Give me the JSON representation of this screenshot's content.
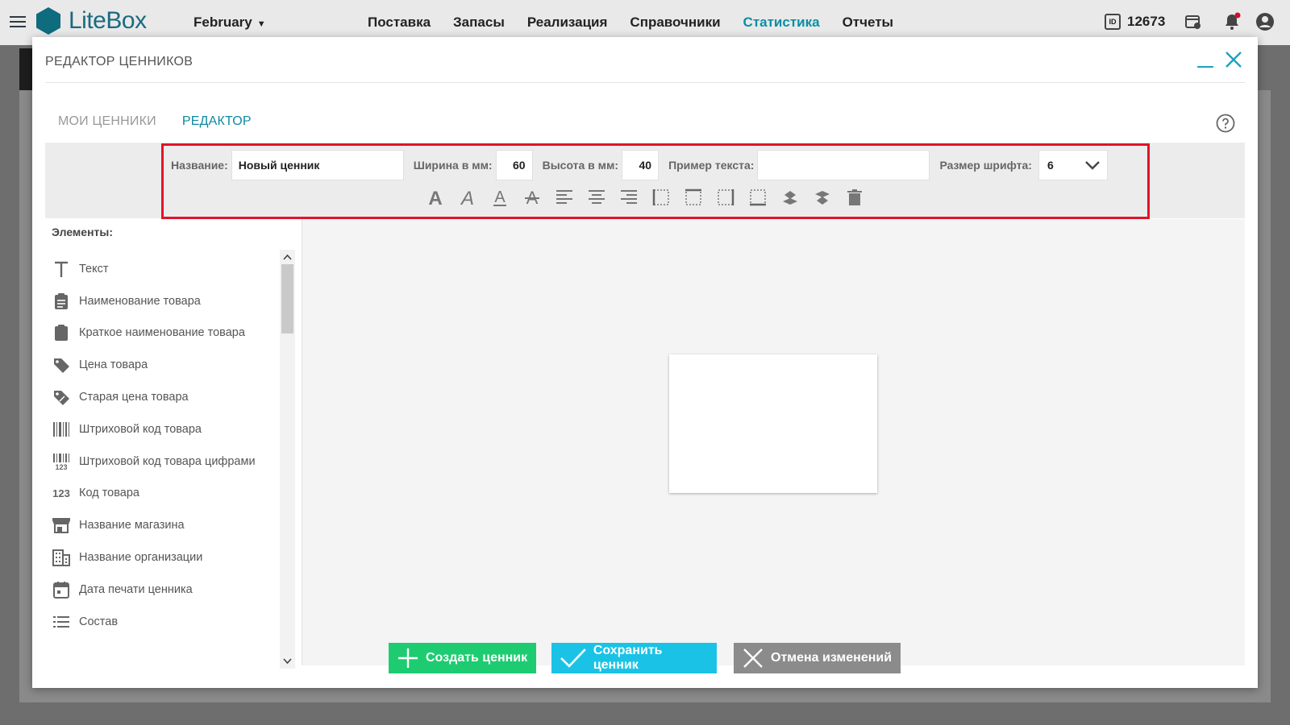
{
  "app": {
    "logo_text": "LiteBox",
    "month": "February",
    "nav": [
      "Поставка",
      "Запасы",
      "Реализация",
      "Справочники",
      "Статистика",
      "Отчеты"
    ],
    "nav_active": "Статистика",
    "account_id_badge": "ID",
    "account_id": "12673"
  },
  "modal": {
    "title": "РЕДАКТОР ЦЕННИКОВ",
    "tabs": [
      "МОИ ЦЕННИКИ",
      "РЕДАКТОР"
    ],
    "active_tab": "РЕДАКТОР",
    "toolbar": {
      "name_label": "Название:",
      "name_value": "Новый ценник",
      "width_label": "Ширина в мм:",
      "width_value": "60",
      "height_label": "Высота в мм:",
      "height_value": "40",
      "sample_label": "Пример текста:",
      "sample_value": "",
      "font_size_label": "Размер шрифта:",
      "font_size_value": "6",
      "tools": [
        "bold-icon",
        "italic-icon",
        "underline-icon",
        "strikethrough-icon",
        "align-left-icon",
        "align-center-icon",
        "align-right-icon",
        "border-left-icon",
        "border-top-icon",
        "border-right-icon",
        "border-bottom-icon",
        "bring-forward-icon",
        "send-backward-icon",
        "delete-icon"
      ]
    },
    "elements_heading": "Элементы:",
    "elements": [
      {
        "icon": "text-icon",
        "label": "Текст"
      },
      {
        "icon": "clipboard-icon",
        "label": "Наименование товара"
      },
      {
        "icon": "clipboard-icon",
        "label": "Краткое наименование товара"
      },
      {
        "icon": "tag-icon",
        "label": "Цена товара"
      },
      {
        "icon": "discount-tag-icon",
        "label": "Старая цена товара"
      },
      {
        "icon": "barcode-icon",
        "label": "Штриховой код товара"
      },
      {
        "icon": "barcode-digits-icon",
        "label": "Штриховой код товара цифрами"
      },
      {
        "icon": "numeric-icon",
        "label": "Код товара"
      },
      {
        "icon": "store-icon",
        "label": "Название магазина"
      },
      {
        "icon": "building-icon",
        "label": "Название организации"
      },
      {
        "icon": "calendar-icon",
        "label": "Дата печати ценника"
      },
      {
        "icon": "list-icon",
        "label": "Состав"
      }
    ],
    "buttons": {
      "create": "Создать ценник",
      "save": "Сохранить ценник",
      "cancel": "Отмена изменений"
    }
  },
  "colors": {
    "accent": "#0e8aa0",
    "highlight": "#e0142a",
    "create": "#1dcc71",
    "save": "#1ac3e6",
    "cancel": "#8b8b8b"
  }
}
